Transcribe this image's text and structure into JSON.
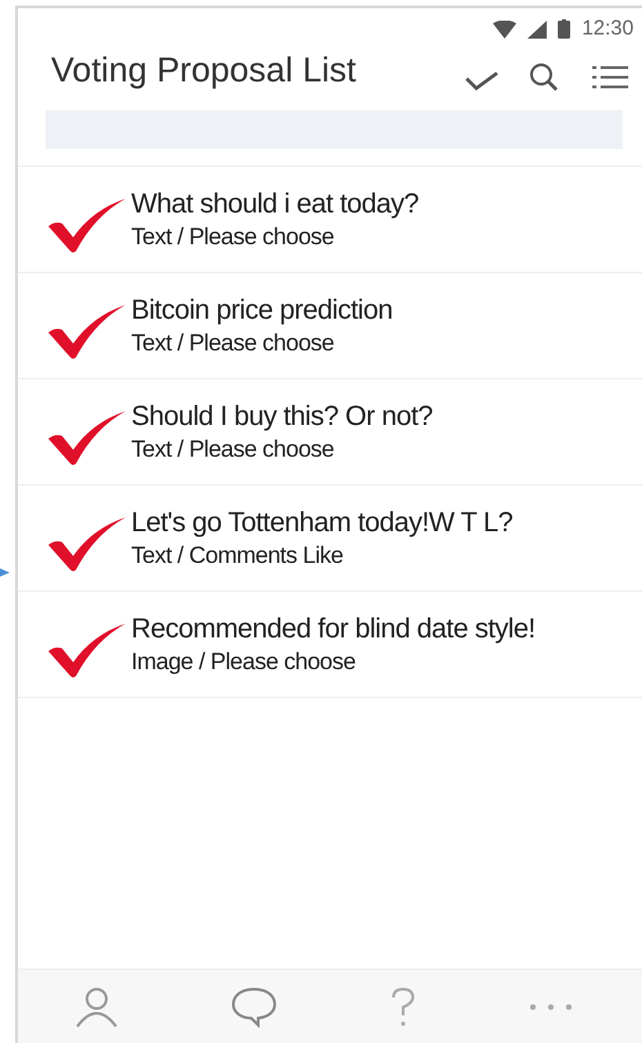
{
  "status_bar": {
    "time": "12:30"
  },
  "header": {
    "title": "Voting Proposal List"
  },
  "proposals": [
    {
      "title": "What should i eat today?",
      "subtitle": "Text / Please choose"
    },
    {
      "title": "Bitcoin price prediction",
      "subtitle": "Text / Please choose"
    },
    {
      "title": "Should I buy this? Or not?",
      "subtitle": "Text / Please choose"
    },
    {
      "title": "Let's go Tottenham today!W T L?",
      "subtitle": "Text / Comments Like"
    },
    {
      "title": "Recommended for blind date style!",
      "subtitle": "Image / Please choose"
    }
  ]
}
